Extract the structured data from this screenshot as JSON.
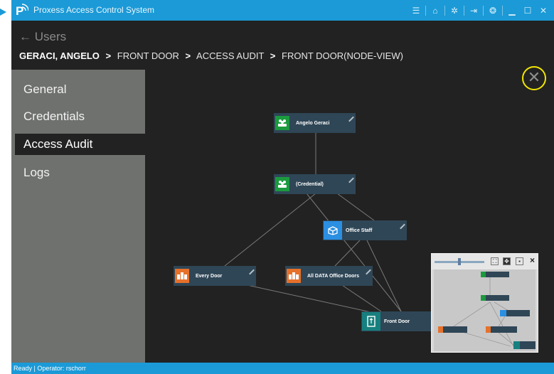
{
  "app": {
    "title": "Proxess Access Control System",
    "accent_color": "#1b9ad7",
    "title_icons": [
      "menu-icon",
      "home-icon",
      "gear-icon",
      "logout-icon",
      "spinner-icon",
      "minimize-icon",
      "maximize-icon",
      "close-icon"
    ]
  },
  "header": {
    "back_label": "← Users",
    "breadcrumb": {
      "user": "GERACI, ANGELO",
      "separator": ">",
      "items": [
        "FRONT DOOR",
        "ACCESS AUDIT",
        "FRONT DOOR(NODE-VIEW)"
      ]
    }
  },
  "sidebar": {
    "items": [
      {
        "label": "General",
        "active": false
      },
      {
        "label": "Credentials",
        "active": false
      },
      {
        "label": "Access Audit",
        "active": true
      },
      {
        "label": "Logs",
        "active": false
      }
    ]
  },
  "close_label": "✕",
  "graph": {
    "nodes": [
      {
        "id": "angelo",
        "label": "Angelo Geraci",
        "icon": "people-icon",
        "color": "#1c9a3e"
      },
      {
        "id": "credential",
        "label": "(Credential)",
        "icon": "people-icon",
        "color": "#1c9a3e"
      },
      {
        "id": "office",
        "label": "Office Staff",
        "icon": "box-icon",
        "color": "#2b8fe2"
      },
      {
        "id": "every",
        "label": "Every Door",
        "icon": "building-icon",
        "color": "#e6712b"
      },
      {
        "id": "alldata",
        "label": "All DATA Office Doors",
        "icon": "building-icon",
        "color": "#e6712b"
      },
      {
        "id": "front",
        "label": "Front Door",
        "icon": "door-icon",
        "color": "#17807f"
      }
    ]
  },
  "minimap": {
    "close_label": "×"
  },
  "status": {
    "text": "Ready | Operator: rschorr"
  }
}
